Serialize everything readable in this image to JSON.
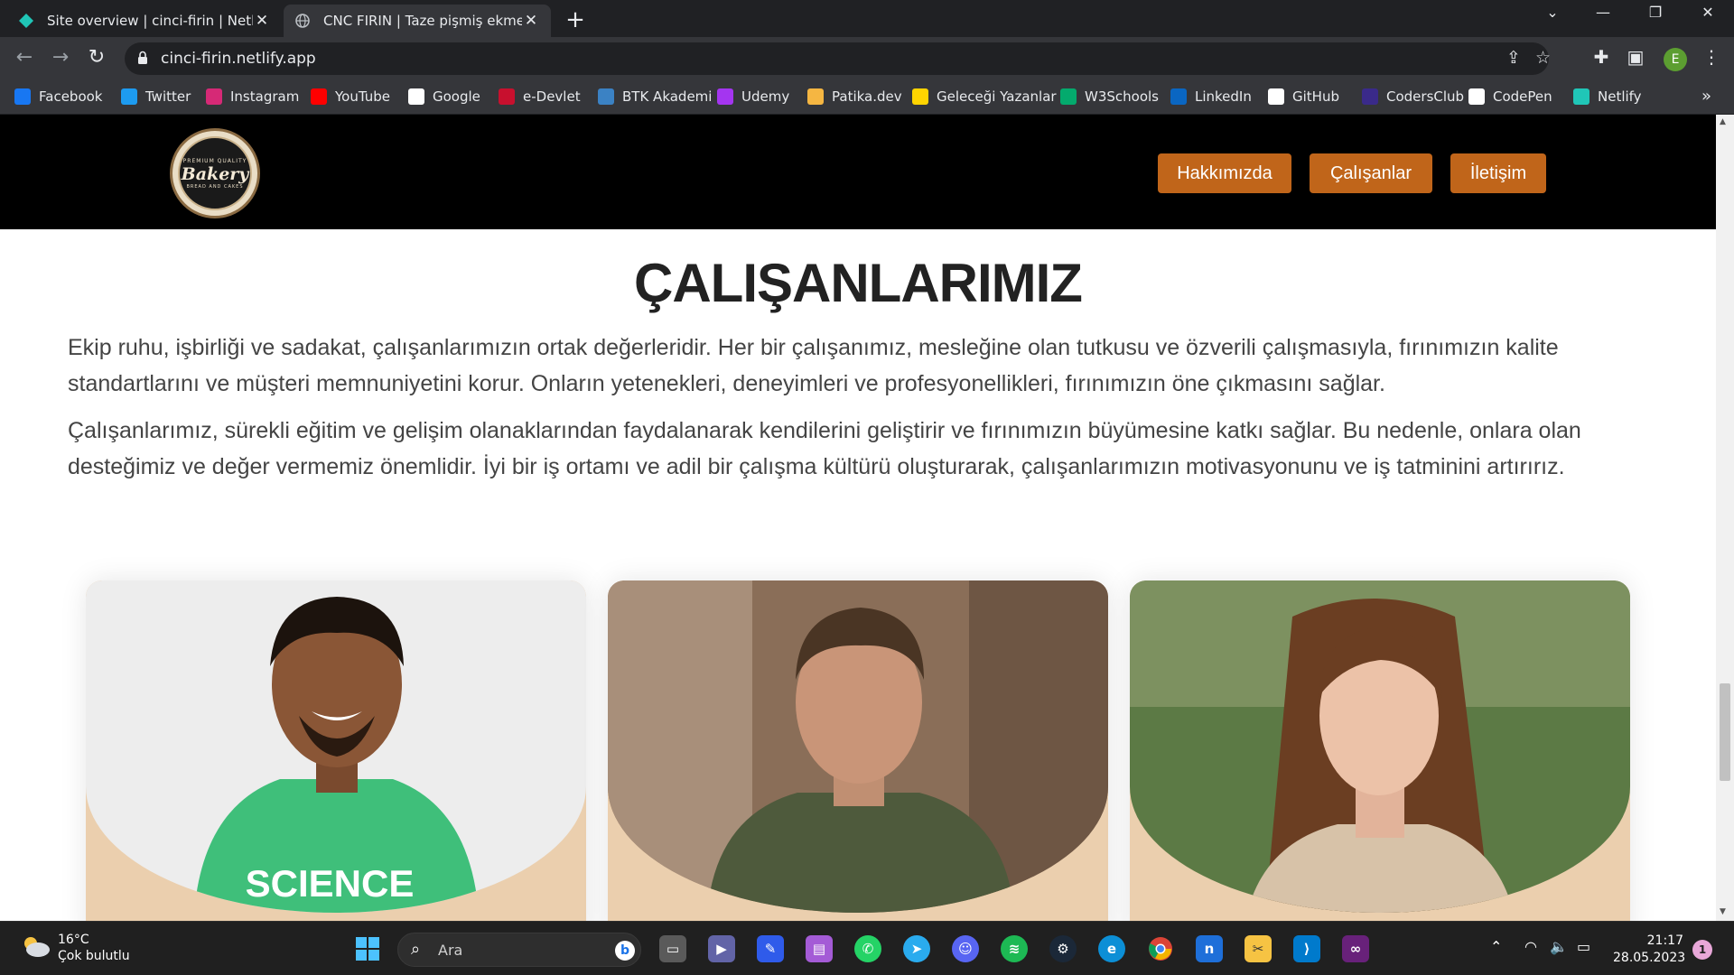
{
  "browser": {
    "tabs": [
      {
        "title": "Site overview | cinci-firin | Netlify",
        "active": false
      },
      {
        "title": "CNC FIRIN | Taze pişmiş ekmekler",
        "active": true
      }
    ],
    "url": "cinci-firin.netlify.app",
    "profile_initial": "E",
    "bookmarks": [
      {
        "label": "Facebook",
        "icon": "facebook-icon",
        "color": "#1877f2"
      },
      {
        "label": "Twitter",
        "icon": "twitter-icon",
        "color": "#1d9bf0"
      },
      {
        "label": "Instagram",
        "icon": "instagram-icon",
        "color": "#d62976"
      },
      {
        "label": "YouTube",
        "icon": "youtube-icon",
        "color": "#ff0000"
      },
      {
        "label": "Google",
        "icon": "google-icon",
        "color": "#ffffff"
      },
      {
        "label": "e-Devlet",
        "icon": "edevlet-icon",
        "color": "#c8102e"
      },
      {
        "label": "BTK Akademi",
        "icon": "btk-icon",
        "color": "#3b82c4"
      },
      {
        "label": "Udemy",
        "icon": "udemy-icon",
        "color": "#a435f0"
      },
      {
        "label": "Patika.dev",
        "icon": "patika-icon",
        "color": "#f5b642"
      },
      {
        "label": "Geleceği Yazanlar",
        "icon": "gelecegi-yazanlar-icon",
        "color": "#ffd400"
      },
      {
        "label": "W3Schools",
        "icon": "w3schools-icon",
        "color": "#04aa6d"
      },
      {
        "label": "LinkedIn",
        "icon": "linkedin-icon",
        "color": "#0a66c2"
      },
      {
        "label": "GitHub",
        "icon": "github-icon",
        "color": "#ffffff"
      },
      {
        "label": "CodersClub",
        "icon": "codersclub-icon",
        "color": "#3a2a8a"
      },
      {
        "label": "CodePen",
        "icon": "codepen-icon",
        "color": "#ffffff"
      },
      {
        "label": "Netlify",
        "icon": "netlify-icon",
        "color": "#20c6b7"
      }
    ]
  },
  "site": {
    "logo": {
      "top": "PREMIUM QUALITY",
      "main": "Bakery",
      "bottom": "BREAD AND CAKES"
    },
    "nav": [
      "Hakkımızda",
      "Çalışanlar",
      "İletişim"
    ],
    "accent_color": "#c0651a",
    "heading": "ÇALIŞANLARIMIZ",
    "paragraphs": [
      "Ekip ruhu, işbirliği ve sadakat, çalışanlarımızın ortak değerleridir. Her bir çalışanımız, mesleğine olan tutkusu ve özverili çalışmasıyla, fırınımızın kalite standartlarını ve müşteri memnuniyetini korur. Onların yetenekleri, deneyimleri ve profesyonellikleri, fırınımızın öne çıkmasını sağlar.",
      "Çalışanlarımız, sürekli eğitim ve gelişim olanaklarından faydalanarak kendilerini geliştirir ve fırınımızın büyümesine katkı sağlar. Bu nedenle, onlara olan desteğimiz ve değer vermemiz önemlidir. İyi bir iş ortamı ve adil bir çalışma kültürü oluşturarak, çalışanlarımızın motivasyonunu ve iş tatminini artırırız."
    ],
    "employee_photo_text": "SCIENCE"
  },
  "taskbar": {
    "weather_temp": "16°C",
    "weather_desc": "Çok bulutlu",
    "search_placeholder": "Ara",
    "time": "21:17",
    "date": "28.05.2023",
    "notification_count": "1"
  }
}
